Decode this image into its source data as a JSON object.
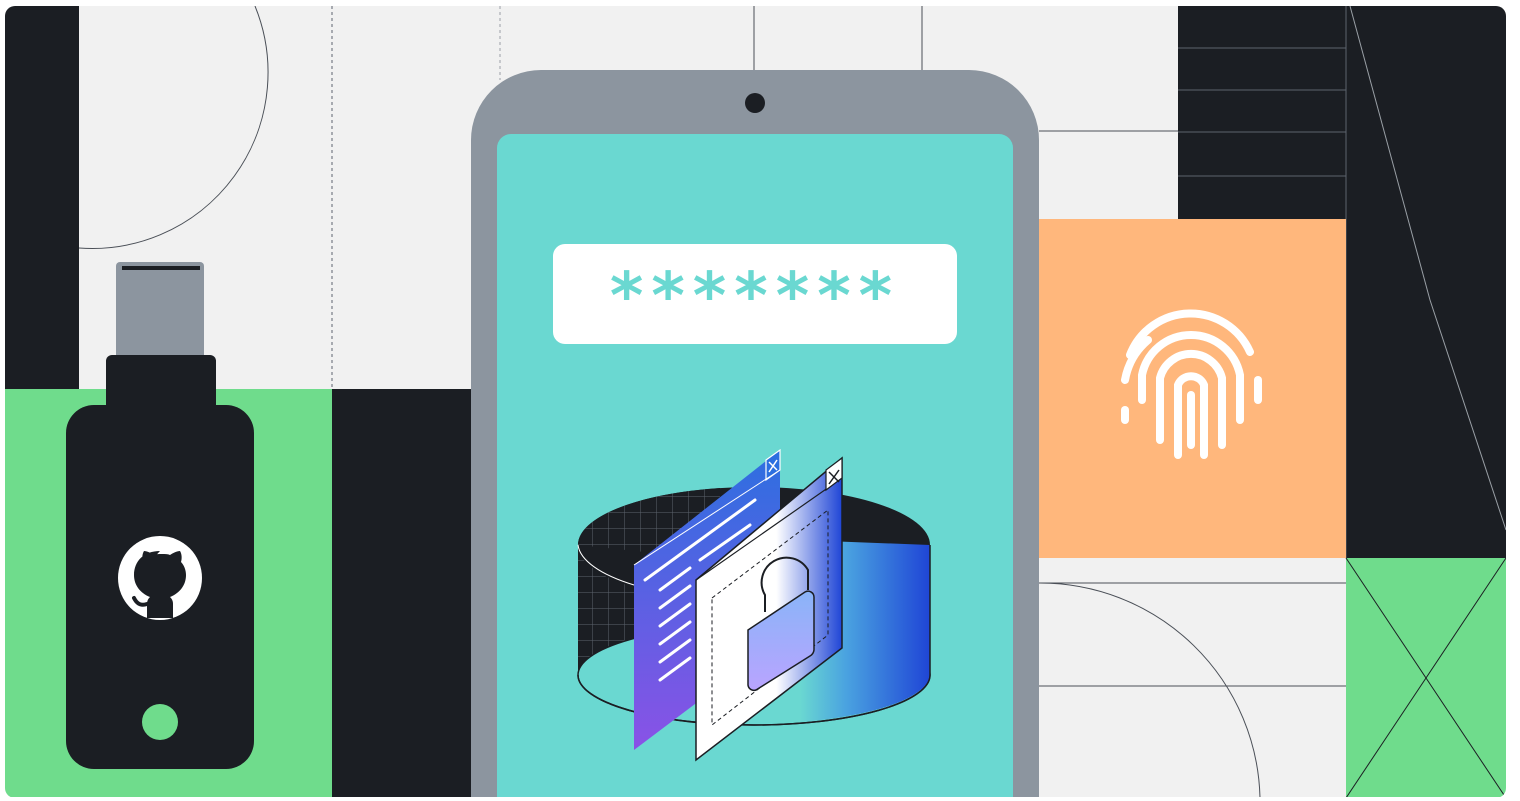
{
  "illustration": {
    "password_field": {
      "masked_value": "*******"
    },
    "icons": {
      "security_key": "github-security-key-icon",
      "fingerprint": "fingerprint-icon",
      "lock": "lock-icon",
      "close": "close-icon"
    },
    "colors": {
      "background": "#f1f1f1",
      "dark": "#1b1e23",
      "green": "#6fdc8c",
      "orange": "#ffb77c",
      "phone_frame": "#8c959f",
      "phone_screen": "#6ad8d1",
      "blue": "#1f4fd8",
      "purple": "#7a52e8"
    }
  }
}
